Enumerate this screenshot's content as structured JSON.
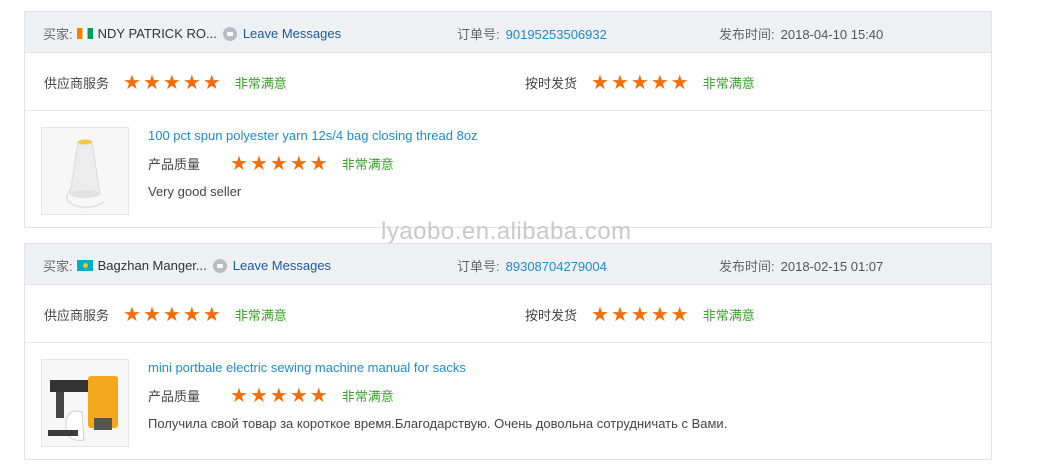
{
  "watermark": "lyaobo.en.alibaba.com",
  "colors": {
    "accent_orange": "#f26e0a",
    "satisfied_green": "#3aa02a",
    "link_blue": "#1f8ad0"
  },
  "reviews": [
    {
      "buyer_label": "买家:",
      "buyer_flag": "cote-divoire-flag",
      "buyer_name": "NDY PATRICK RO...",
      "leave_messages": "Leave Messages",
      "order_label": "订单号:",
      "order_number": "90195253506932",
      "time_label": "发布时间:",
      "time_value": "2018-04-10 15:40",
      "supplier_service_label": "供应商服务",
      "supplier_service_stars": 5,
      "supplier_service_text": "非常满意",
      "on_time_label": "按时发货",
      "on_time_stars": 5,
      "on_time_text": "非常满意",
      "product_title": "100 pct spun polyester yarn 12s/4 bag closing thread 8oz",
      "quality_label": "产品质量",
      "quality_stars": 5,
      "quality_text": "非常满意",
      "review_text": "Very good seller"
    },
    {
      "buyer_label": "买家:",
      "buyer_flag": "kazakhstan-flag",
      "buyer_name": "Bagzhan Manger...",
      "leave_messages": "Leave Messages",
      "order_label": "订单号:",
      "order_number": "89308704279004",
      "time_label": "发布时间:",
      "time_value": "2018-02-15 01:07",
      "supplier_service_label": "供应商服务",
      "supplier_service_stars": 5,
      "supplier_service_text": "非常满意",
      "on_time_label": "按时发货",
      "on_time_stars": 5,
      "on_time_text": "非常满意",
      "product_title": "mini portbale electric sewing machine manual for sacks",
      "quality_label": "产品质量",
      "quality_stars": 5,
      "quality_text": "非常满意",
      "review_text": "Получила свой товар за короткое время.Благодарствую. Очень довольна сотрудничать с Вами."
    }
  ]
}
